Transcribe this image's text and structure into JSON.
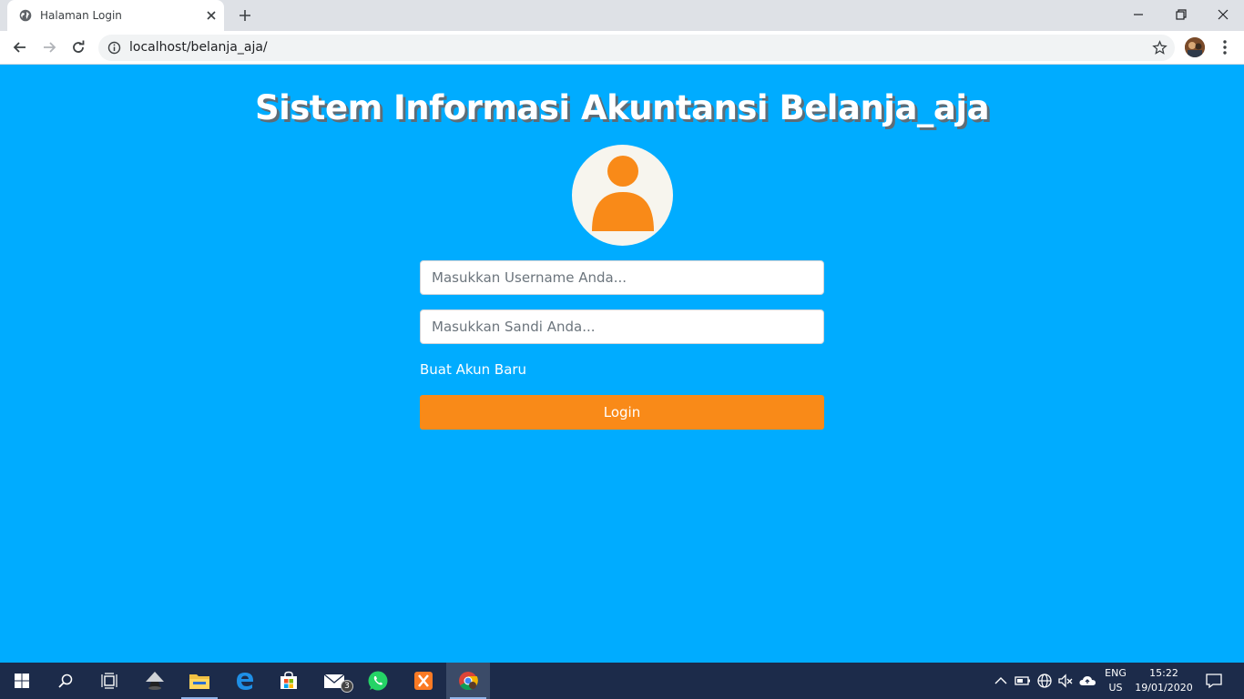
{
  "browser": {
    "tab_title": "Halaman Login",
    "url": "localhost/belanja_aja/"
  },
  "page": {
    "title": "Sistem Informasi Akuntansi Belanja_aja",
    "username_placeholder": "Masukkan Username Anda...",
    "password_placeholder": "Masukkan Sandi Anda...",
    "register_link": "Buat Akun Baru",
    "login_button": "Login"
  },
  "taskbar": {
    "mail_badge": "3",
    "language_line1": "ENG",
    "language_line2": "US",
    "time": "15:22",
    "date": "19/01/2020"
  },
  "colors": {
    "page_background": "#00acff",
    "accent_orange": "#f98a18",
    "taskbar": "#1c2b4a"
  },
  "icons": [
    "globe-icon",
    "close-icon",
    "plus-icon",
    "minimize-icon",
    "restore-icon",
    "back-icon",
    "forward-icon",
    "reload-icon",
    "info-icon",
    "star-icon",
    "menu-icon",
    "user-icon",
    "windows-icon",
    "search-icon",
    "task-view-icon",
    "inkscape-icon",
    "file-explorer-icon",
    "edge-icon",
    "store-icon",
    "mail-icon",
    "whatsapp-icon",
    "xampp-icon",
    "chrome-icon",
    "chevron-up-icon",
    "battery-icon",
    "network-icon",
    "speaker-muted-icon",
    "cloud-icon",
    "notification-icon"
  ]
}
